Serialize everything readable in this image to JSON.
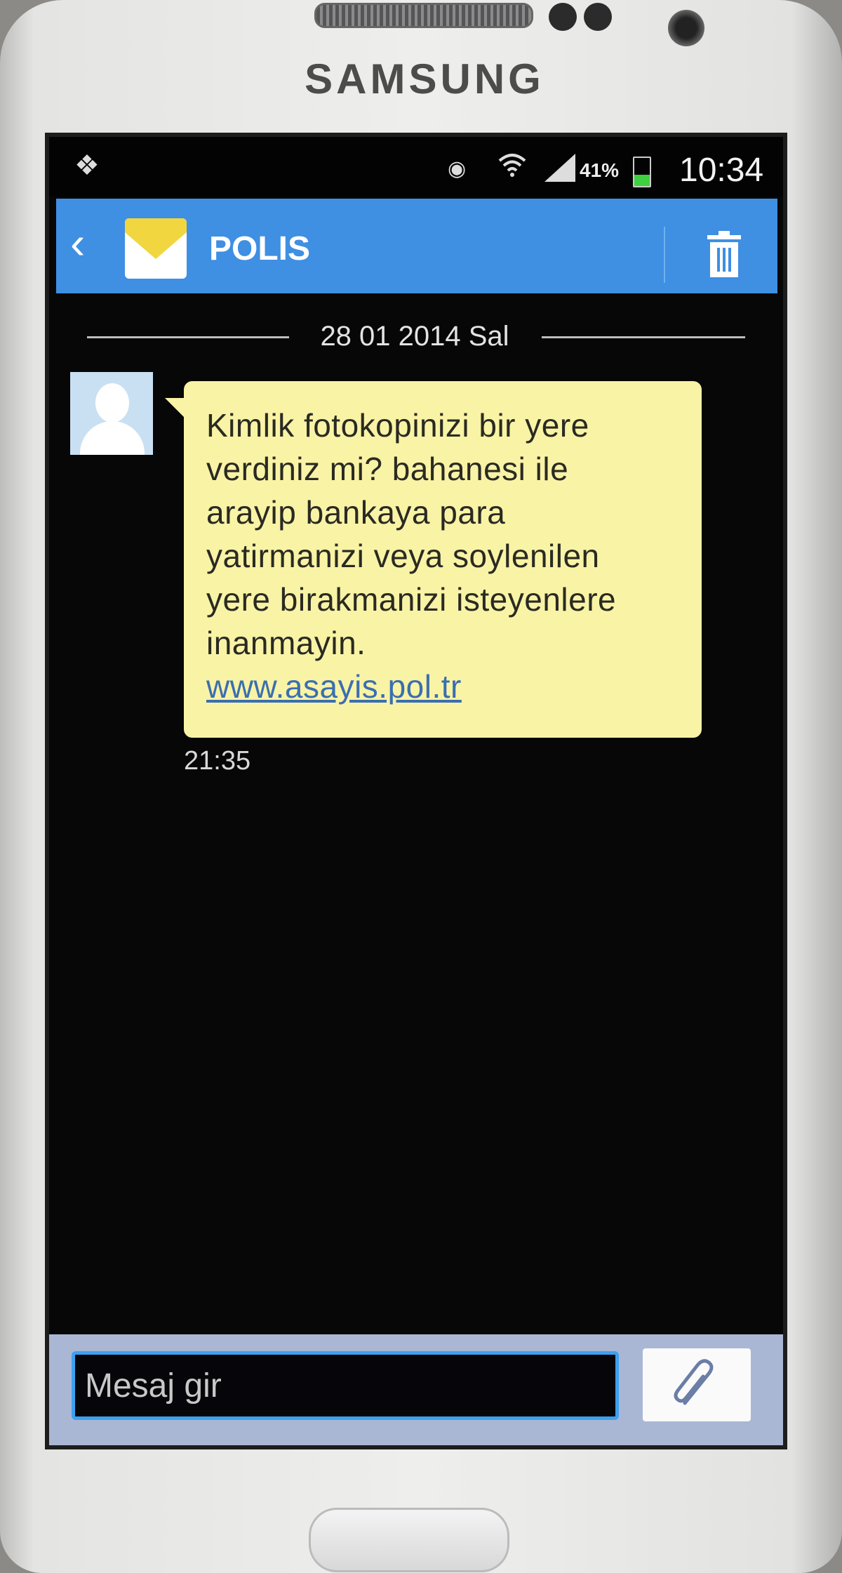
{
  "device": {
    "brand": "SAMSUNG"
  },
  "status_bar": {
    "battery_percent": "41%",
    "battery_level": 0.41,
    "time": "10:34"
  },
  "app_bar": {
    "title": "POLIS"
  },
  "conversation": {
    "date": "28 01 2014 Sal",
    "message": {
      "lines": [
        "Kimlik fotokopinizi bir yere",
        "verdiniz mi? bahanesi ile",
        "arayip bankaya para",
        "yatirmanizi veya soylenilen",
        "yere birakmanizi isteyenlere",
        "inanmayin."
      ],
      "link": "www.asayis.pol.tr",
      "time": "21:35"
    }
  },
  "composer": {
    "placeholder": "Mesaj gir"
  },
  "colors": {
    "app_bar": "#3f8fe3",
    "bubble": "#f9f3a6",
    "input_border": "#3da0f0"
  }
}
